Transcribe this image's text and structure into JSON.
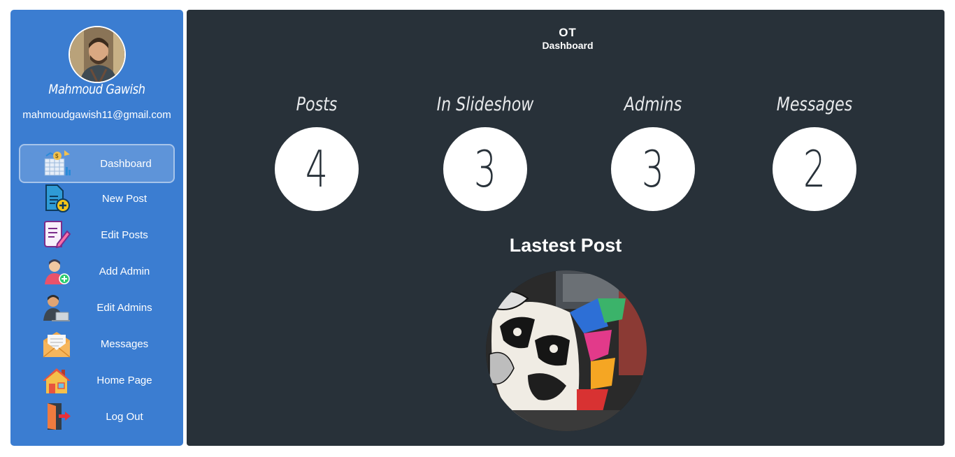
{
  "sidebar": {
    "user_name": "Mahmoud Gawish",
    "user_email": "mahmoudgawish11@gmail.com",
    "items": [
      {
        "label": "Dashboard",
        "icon": "dashboard-icon",
        "active": true
      },
      {
        "label": "New Post",
        "icon": "new-post-icon"
      },
      {
        "label": "Edit Posts",
        "icon": "edit-posts-icon"
      },
      {
        "label": "Add Admin",
        "icon": "add-admin-icon"
      },
      {
        "label": "Edit Admins",
        "icon": "edit-admins-icon"
      },
      {
        "label": "Messages",
        "icon": "messages-icon"
      },
      {
        "label": "Home Page",
        "icon": "home-icon"
      },
      {
        "label": "Log Out",
        "icon": "logout-icon"
      }
    ]
  },
  "header": {
    "logo_mark": "OT",
    "logo_text": "Dashboard"
  },
  "stats": [
    {
      "label": "Posts",
      "value": "4"
    },
    {
      "label": "In Slideshow",
      "value": "3"
    },
    {
      "label": "Admins",
      "value": "3"
    },
    {
      "label": "Messages",
      "value": "2"
    }
  ],
  "latest": {
    "title": "Lastest Post"
  },
  "colors": {
    "sidebar_bg": "#3b7dd1",
    "main_bg": "#283139",
    "circle_bg": "#ffffff"
  }
}
